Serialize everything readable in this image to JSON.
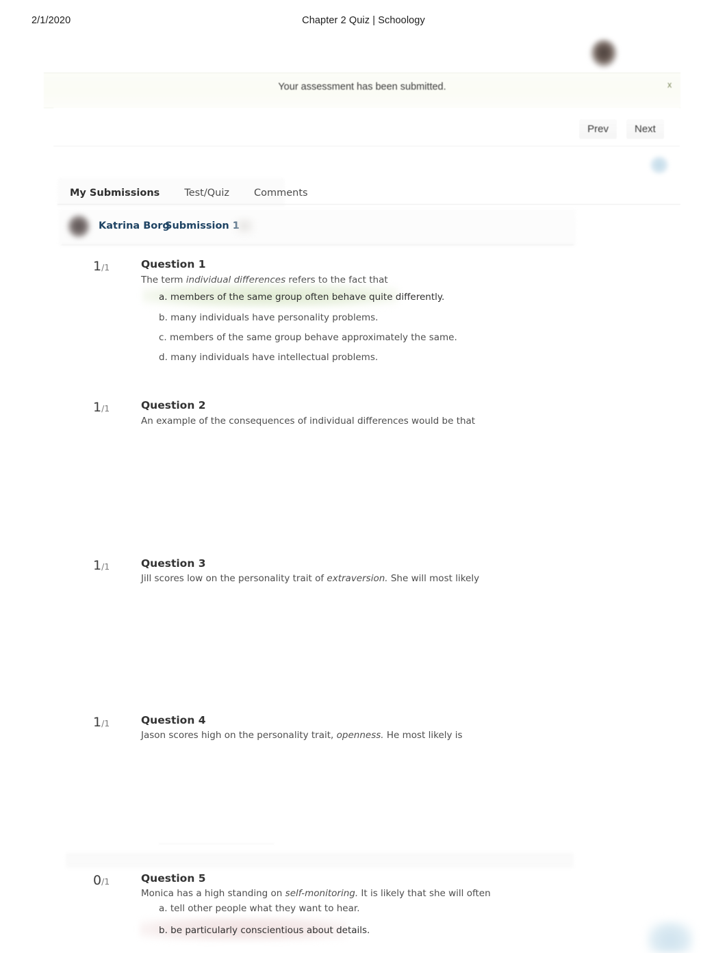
{
  "print_header": {
    "date": "2/1/2020",
    "title": "Chapter 2 Quiz | Schoology"
  },
  "banner": {
    "message": "Your assessment has been submitted.",
    "close_label": "x"
  },
  "pager": {
    "prev_label": "Prev",
    "next_label": "Next"
  },
  "tabs": [
    {
      "label": "My Submissions",
      "active": true
    },
    {
      "label": "Test/Quiz",
      "active": false
    },
    {
      "label": "Comments",
      "active": false
    }
  ],
  "submission": {
    "student_name": "Katrina Borg",
    "submission_label": "Submission 1"
  },
  "colors": {
    "correct_highlight": "#dfead1",
    "incorrect_highlight": "#f0e0e0",
    "link": "#1f4464",
    "close_icon": "#7f8a5e",
    "accent_blue": "#cfe2ee"
  },
  "questions": [
    {
      "score": "1",
      "denominator": "/1",
      "title": "Question 1",
      "prompt_parts": [
        {
          "text": "The term ",
          "italic": false
        },
        {
          "text": "individual differences",
          "italic": true
        },
        {
          "text": " refers to the fact that",
          "italic": false
        }
      ],
      "options": [
        {
          "label": "a. members of the same group often behave quite differently.",
          "state": "correct"
        },
        {
          "label": "b. many individuals have personality problems.",
          "state": "normal"
        },
        {
          "label": "c. members of the same group behave approximately the same.",
          "state": "normal"
        },
        {
          "label": "d. many individuals have intellectual problems.",
          "state": "normal"
        }
      ]
    },
    {
      "score": "1",
      "denominator": "/1",
      "title": "Question 2",
      "prompt_parts": [
        {
          "text": "An example of the consequences of individual differences would be that",
          "italic": false
        }
      ],
      "options": []
    },
    {
      "score": "1",
      "denominator": "/1",
      "title": "Question 3",
      "prompt_parts": [
        {
          "text": "Jill scores low on the personality trait of ",
          "italic": false
        },
        {
          "text": "extraversion.",
          "italic": true
        },
        {
          "text": " She will most likely",
          "italic": false
        }
      ],
      "options": []
    },
    {
      "score": "1",
      "denominator": "/1",
      "title": "Question 4",
      "prompt_parts": [
        {
          "text": "Jason scores high on the personality trait, ",
          "italic": false
        },
        {
          "text": "openness.",
          "italic": true
        },
        {
          "text": "  He most likely is",
          "italic": false
        }
      ],
      "options": []
    },
    {
      "score": "0",
      "denominator": "/1",
      "title": "Question 5",
      "prompt_parts": [
        {
          "text": "Monica has a high standing on ",
          "italic": false
        },
        {
          "text": "self-monitoring.",
          "italic": true
        },
        {
          "text": " It is likely that she will often",
          "italic": false
        }
      ],
      "options": [
        {
          "label": "a. tell other people what they want to hear.",
          "state": "normal"
        },
        {
          "label": "b. be particularly conscientious about details.",
          "state": "incorrect"
        }
      ]
    }
  ]
}
